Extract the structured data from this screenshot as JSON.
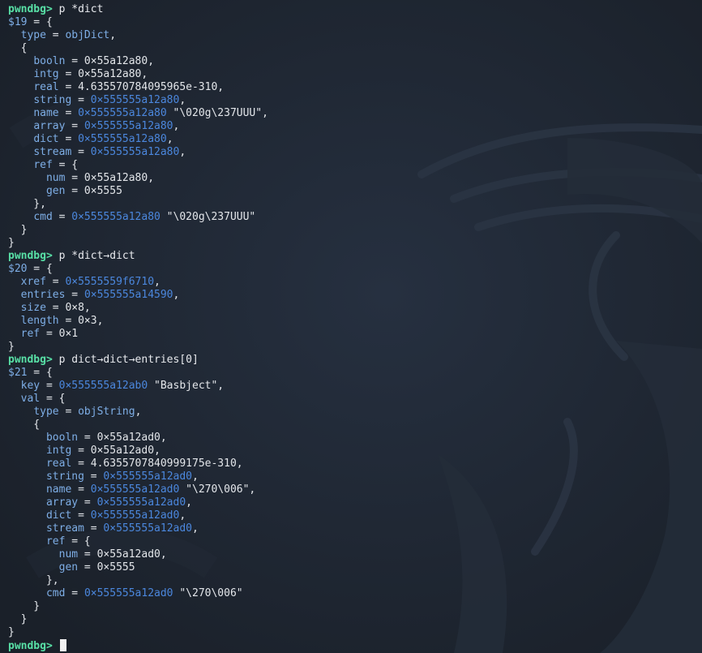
{
  "theme": {
    "background": "#1d2430",
    "prompt": "#58e0a6",
    "text": "#e3e6ea",
    "key": "#7eaee6",
    "address": "#4b87dd"
  },
  "terminal": {
    "lines": [
      [
        {
          "t": "pwndbg>",
          "c": "prompt"
        },
        {
          "t": " p *dict",
          "c": "cmd"
        }
      ],
      [
        {
          "t": "$19",
          "c": "hist"
        },
        {
          "t": " = {"
        }
      ],
      [
        {
          "t": "  "
        },
        {
          "t": "type",
          "c": "key"
        },
        {
          "t": " = "
        },
        {
          "t": "objDict",
          "c": "typeval"
        },
        {
          "t": ","
        }
      ],
      [
        {
          "t": "  {"
        }
      ],
      [
        {
          "t": "    "
        },
        {
          "t": "booln",
          "c": "key"
        },
        {
          "t": " = 0×55a12a80,"
        }
      ],
      [
        {
          "t": "    "
        },
        {
          "t": "intg",
          "c": "key"
        },
        {
          "t": " = 0×55a12a80,"
        }
      ],
      [
        {
          "t": "    "
        },
        {
          "t": "real",
          "c": "key"
        },
        {
          "t": " = 4.635570784095965e-310,"
        }
      ],
      [
        {
          "t": "    "
        },
        {
          "t": "string",
          "c": "key"
        },
        {
          "t": " = "
        },
        {
          "t": "0×555555a12a80",
          "c": "addr"
        },
        {
          "t": ","
        }
      ],
      [
        {
          "t": "    "
        },
        {
          "t": "name",
          "c": "key"
        },
        {
          "t": " = "
        },
        {
          "t": "0×555555a12a80",
          "c": "addr"
        },
        {
          "t": " \"\\020g\\237UUU\","
        }
      ],
      [
        {
          "t": "    "
        },
        {
          "t": "array",
          "c": "key"
        },
        {
          "t": " = "
        },
        {
          "t": "0×555555a12a80",
          "c": "addr"
        },
        {
          "t": ","
        }
      ],
      [
        {
          "t": "    "
        },
        {
          "t": "dict",
          "c": "key"
        },
        {
          "t": " = "
        },
        {
          "t": "0×555555a12a80",
          "c": "addr"
        },
        {
          "t": ","
        }
      ],
      [
        {
          "t": "    "
        },
        {
          "t": "stream",
          "c": "key"
        },
        {
          "t": " = "
        },
        {
          "t": "0×555555a12a80",
          "c": "addr"
        },
        {
          "t": ","
        }
      ],
      [
        {
          "t": "    "
        },
        {
          "t": "ref",
          "c": "key"
        },
        {
          "t": " = {"
        }
      ],
      [
        {
          "t": "      "
        },
        {
          "t": "num",
          "c": "key"
        },
        {
          "t": " = 0×55a12a80,"
        }
      ],
      [
        {
          "t": "      "
        },
        {
          "t": "gen",
          "c": "key"
        },
        {
          "t": " = 0×5555"
        }
      ],
      [
        {
          "t": "    },"
        }
      ],
      [
        {
          "t": "    "
        },
        {
          "t": "cmd",
          "c": "key"
        },
        {
          "t": " = "
        },
        {
          "t": "0×555555a12a80",
          "c": "addr"
        },
        {
          "t": " \"\\020g\\237UUU\""
        }
      ],
      [
        {
          "t": "  }"
        }
      ],
      [
        {
          "t": "}"
        }
      ],
      [
        {
          "t": "pwndbg>",
          "c": "prompt"
        },
        {
          "t": " p *dict→dict",
          "c": "cmd"
        }
      ],
      [
        {
          "t": "$20",
          "c": "hist"
        },
        {
          "t": " = {"
        }
      ],
      [
        {
          "t": "  "
        },
        {
          "t": "xref",
          "c": "key"
        },
        {
          "t": " = "
        },
        {
          "t": "0×5555559f6710",
          "c": "addr"
        },
        {
          "t": ","
        }
      ],
      [
        {
          "t": "  "
        },
        {
          "t": "entries",
          "c": "key"
        },
        {
          "t": " = "
        },
        {
          "t": "0×555555a14590",
          "c": "addr"
        },
        {
          "t": ","
        }
      ],
      [
        {
          "t": "  "
        },
        {
          "t": "size",
          "c": "key"
        },
        {
          "t": " = 0×8,"
        }
      ],
      [
        {
          "t": "  "
        },
        {
          "t": "length",
          "c": "key"
        },
        {
          "t": " = 0×3,"
        }
      ],
      [
        {
          "t": "  "
        },
        {
          "t": "ref",
          "c": "key"
        },
        {
          "t": " = 0×1"
        }
      ],
      [
        {
          "t": "}"
        }
      ],
      [
        {
          "t": "pwndbg>",
          "c": "prompt"
        },
        {
          "t": " p dict→dict→entries[0]",
          "c": "cmd"
        }
      ],
      [
        {
          "t": "$21",
          "c": "hist"
        },
        {
          "t": " = {"
        }
      ],
      [
        {
          "t": "  "
        },
        {
          "t": "key",
          "c": "key"
        },
        {
          "t": " = "
        },
        {
          "t": "0×555555a12ab0",
          "c": "addr"
        },
        {
          "t": " \"Basbject\","
        }
      ],
      [
        {
          "t": "  "
        },
        {
          "t": "val",
          "c": "key"
        },
        {
          "t": " = {"
        }
      ],
      [
        {
          "t": "    "
        },
        {
          "t": "type",
          "c": "key"
        },
        {
          "t": " = "
        },
        {
          "t": "objString",
          "c": "typeval"
        },
        {
          "t": ","
        }
      ],
      [
        {
          "t": "    {"
        }
      ],
      [
        {
          "t": "      "
        },
        {
          "t": "booln",
          "c": "key"
        },
        {
          "t": " = 0×55a12ad0,"
        }
      ],
      [
        {
          "t": "      "
        },
        {
          "t": "intg",
          "c": "key"
        },
        {
          "t": " = 0×55a12ad0,"
        }
      ],
      [
        {
          "t": "      "
        },
        {
          "t": "real",
          "c": "key"
        },
        {
          "t": " = 4.6355707840999175e-310,"
        }
      ],
      [
        {
          "t": "      "
        },
        {
          "t": "string",
          "c": "key"
        },
        {
          "t": " = "
        },
        {
          "t": "0×555555a12ad0",
          "c": "addr"
        },
        {
          "t": ","
        }
      ],
      [
        {
          "t": "      "
        },
        {
          "t": "name",
          "c": "key"
        },
        {
          "t": " = "
        },
        {
          "t": "0×555555a12ad0",
          "c": "addr"
        },
        {
          "t": " \"\\270\\006\","
        }
      ],
      [
        {
          "t": "      "
        },
        {
          "t": "array",
          "c": "key"
        },
        {
          "t": " = "
        },
        {
          "t": "0×555555a12ad0",
          "c": "addr"
        },
        {
          "t": ","
        }
      ],
      [
        {
          "t": "      "
        },
        {
          "t": "dict",
          "c": "key"
        },
        {
          "t": " = "
        },
        {
          "t": "0×555555a12ad0",
          "c": "addr"
        },
        {
          "t": ","
        }
      ],
      [
        {
          "t": "      "
        },
        {
          "t": "stream",
          "c": "key"
        },
        {
          "t": " = "
        },
        {
          "t": "0×555555a12ad0",
          "c": "addr"
        },
        {
          "t": ","
        }
      ],
      [
        {
          "t": "      "
        },
        {
          "t": "ref",
          "c": "key"
        },
        {
          "t": " = {"
        }
      ],
      [
        {
          "t": "        "
        },
        {
          "t": "num",
          "c": "key"
        },
        {
          "t": " = 0×55a12ad0,"
        }
      ],
      [
        {
          "t": "        "
        },
        {
          "t": "gen",
          "c": "key"
        },
        {
          "t": " = 0×5555"
        }
      ],
      [
        {
          "t": "      },"
        }
      ],
      [
        {
          "t": "      "
        },
        {
          "t": "cmd",
          "c": "key"
        },
        {
          "t": " = "
        },
        {
          "t": "0×555555a12ad0",
          "c": "addr"
        },
        {
          "t": " \"\\270\\006\""
        }
      ],
      [
        {
          "t": "    }"
        }
      ],
      [
        {
          "t": "  }"
        }
      ],
      [
        {
          "t": "}"
        }
      ]
    ],
    "prompt": "pwndbg>",
    "input": ""
  }
}
